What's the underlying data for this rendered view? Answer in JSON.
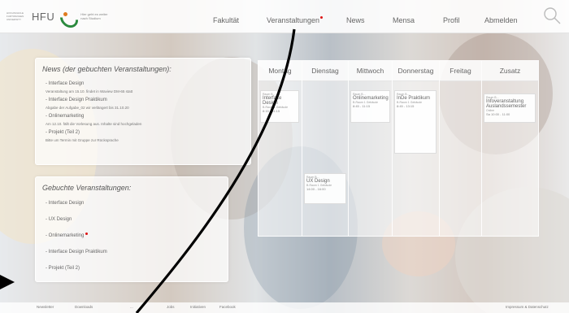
{
  "header": {
    "logo_small_text": "HOCHSCHULE FURTWANGEN UNIVERSITY",
    "logo_text": "HFU",
    "logo_tagline": "Hier geht es weiter nach Studium",
    "nav": [
      "Fakultät",
      "Veranstaltungen",
      "News",
      "Mensa",
      "Profil",
      "Abmelden"
    ],
    "search_icon": "search-icon"
  },
  "news": {
    "title": "News (der gebuchten Veranstaltungen):",
    "lines": [
      {
        "text": "- Interface Design",
        "type": "head"
      },
      {
        "text": "Veranstaltung am 15.10. findet in Waview DM-65 statt",
        "type": "sub"
      },
      {
        "text": "- Interface Design Praktikum",
        "type": "head"
      },
      {
        "text": "Abgabe der Aufgabe_02 wir verlängert bis 31.10.20",
        "type": "sub"
      },
      {
        "text": "- Onlinemarketing",
        "type": "head"
      },
      {
        "text": "Am 12.10. fällt die Vorlesung aus. Inhalte sind hochgeladen",
        "type": "sub"
      },
      {
        "text": "- Projekt (Teil 2)",
        "type": "head"
      },
      {
        "text": "Bitte um Termin mit Gruppe zur Rücksprache",
        "type": "sub"
      }
    ]
  },
  "courses": {
    "title": "Gebuchte Veranstaltungen:",
    "items": [
      {
        "label": "- Interface Design",
        "alert": false
      },
      {
        "label": "- UX Design",
        "alert": false
      },
      {
        "label": "- Onlinemarketing",
        "alert": true
      },
      {
        "label": "- Interface Design Praktikum",
        "alert": false
      },
      {
        "label": "- Projekt (Teil 2)",
        "alert": false
      }
    ]
  },
  "schedule": {
    "days": [
      "Montag",
      "Dienstag",
      "Mittwoch",
      "Donnerstag",
      "Freitag",
      "Zusatz"
    ],
    "events": [
      {
        "day": 0,
        "code": "Raum B...",
        "title": "Interface Design",
        "meta": "B-Raum 1 Gebäude",
        "time": "8:15 - 11:15"
      },
      {
        "day": 1,
        "code": "Raum B...",
        "title": "UX Design",
        "meta": "B-Raum 1 Gebäude",
        "time": "14:00 - 16:00"
      },
      {
        "day": 2,
        "code": "Raum B...",
        "title": "Onlinemarketing",
        "meta": "B-Raum 1 Gebäude",
        "time": "8:45 - 11:15"
      },
      {
        "day": 3,
        "code": "Raum B...",
        "title": "InDe Praktikum",
        "meta": "B-Raum 1 Gebäude",
        "time": "8:45 - 13:15"
      },
      {
        "day": 5,
        "code": "Raum B...",
        "title": "Infoveranstaltung Auslandssemester",
        "meta": "Online",
        "time": "Sa 10:00 - 11:00"
      }
    ]
  },
  "footer": {
    "left": [
      "Newsletter",
      "Downloads",
      "...",
      "Jobs",
      "Initiativen",
      "Facebook"
    ],
    "right": "Impressum & Datenschutz"
  },
  "colors": {
    "accent_red": "#d11111",
    "logo_green": "#2b8a3e",
    "logo_orange": "#e07a1f"
  }
}
